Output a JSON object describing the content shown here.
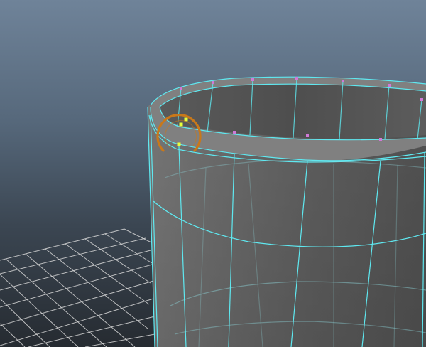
{
  "viewport": {
    "name": "perspective-viewport",
    "background_top": "#6f8399",
    "background_bottom": "#262b31"
  },
  "colors": {
    "wireframe": "#5fe8f0",
    "inner_wire": "#8fd8dc",
    "vertex": "#d07ad8",
    "selected_vertex": "#e8ff3a",
    "manipulator": "#c8781a",
    "grid": "#d6d6d6",
    "mesh_fill": "#6d6d6d"
  },
  "mesh": {
    "object": "cylinder",
    "mode": "vertex-selection"
  },
  "manipulator": {
    "type": "soft-select-falloff-ring"
  }
}
